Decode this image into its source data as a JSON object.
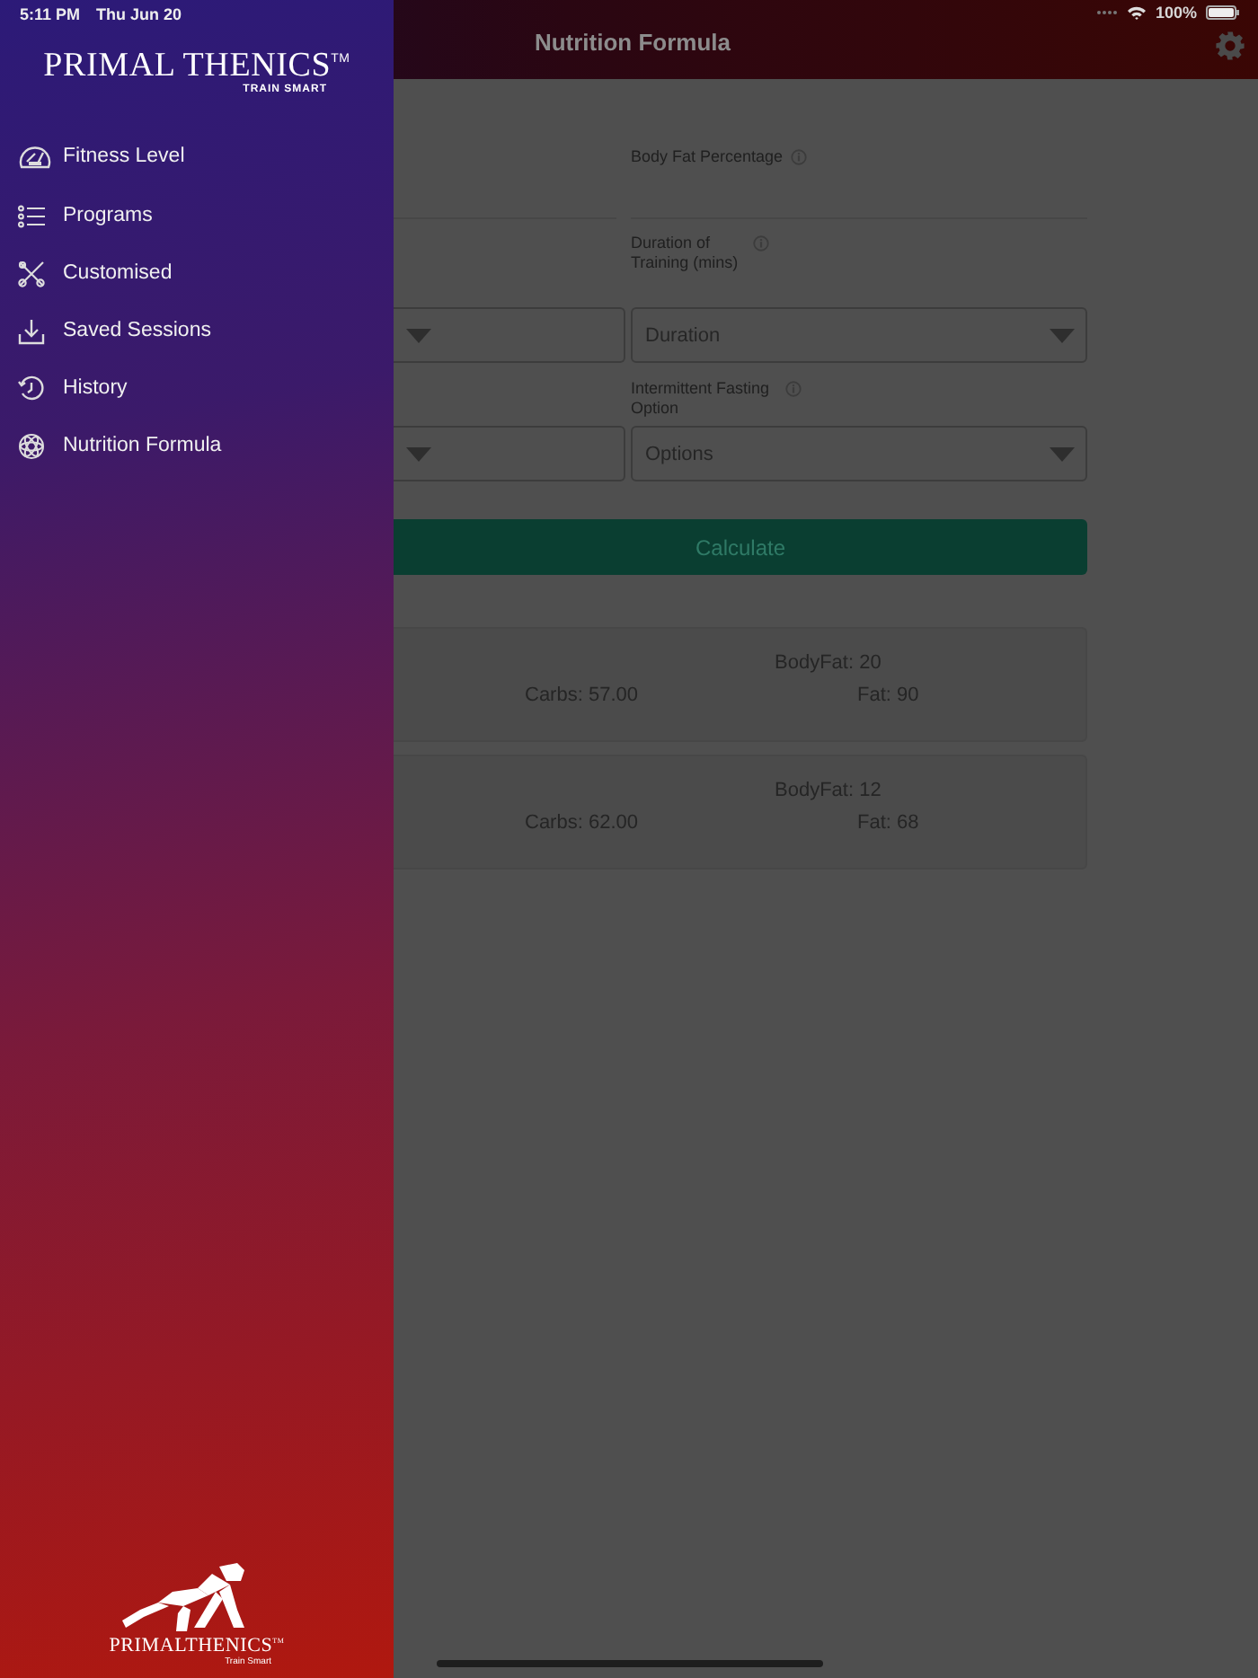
{
  "status_bar": {
    "time": "5:11 PM",
    "date": "Thu Jun 20",
    "battery": "100%"
  },
  "header": {
    "title": "Nutrition Formula"
  },
  "drawer": {
    "logo": {
      "name": "PRIMAL THENICS$^{TM}$",
      "tagline": "TRAIN SMART"
    },
    "items": [
      {
        "label": "Fitness Level"
      },
      {
        "label": "Programs"
      },
      {
        "label": "Customised"
      },
      {
        "label": "Saved Sessions"
      },
      {
        "label": "History"
      },
      {
        "label": "Nutrition Formula"
      }
    ],
    "footer_logo": {
      "name": "PRIMALTHENICS$^{TM}$",
      "tagline": "Train Smart"
    }
  },
  "form": {
    "body_fat_label": "Body Fat Percentage",
    "duration_label": "Duration of Training (mins)",
    "duration_placeholder": "Duration",
    "fasting_label": "Intermittent Fasting Option",
    "fasting_placeholder": "Options",
    "calculate": "Calculate"
  },
  "results": [
    {
      "bodyfat": "BodyFat: 20",
      "carbs": "Carbs: 57.00",
      "fat": "Fat: 90"
    },
    {
      "bodyfat": "BodyFat: 12",
      "carbs": "Carbs: 62.00",
      "fat": "Fat: 68"
    }
  ]
}
